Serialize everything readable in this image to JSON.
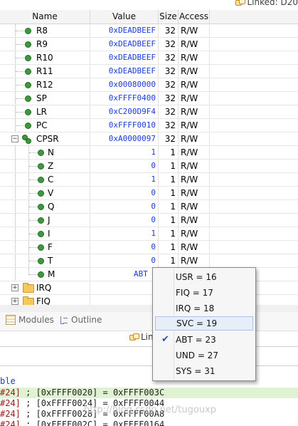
{
  "header": {
    "linked_label": "Linked: D20"
  },
  "columns": {
    "name": "Name",
    "value": "Value",
    "size": "Size",
    "access": "Access"
  },
  "registers": [
    {
      "name": "R8",
      "value": "0xDEADBEEF",
      "size": "32",
      "access": "R/W"
    },
    {
      "name": "R9",
      "value": "0xDEADBEEF",
      "size": "32",
      "access": "R/W"
    },
    {
      "name": "R10",
      "value": "0xDEADBEEF",
      "size": "32",
      "access": "R/W"
    },
    {
      "name": "R11",
      "value": "0xDEADBEEF",
      "size": "32",
      "access": "R/W"
    },
    {
      "name": "R12",
      "value": "0x00080000",
      "size": "32",
      "access": "R/W"
    },
    {
      "name": "SP",
      "value": "0xFFFF0400",
      "size": "32",
      "access": "R/W"
    },
    {
      "name": "LR",
      "value": "0xC200D9F4",
      "size": "32",
      "access": "R/W"
    },
    {
      "name": "PC",
      "value": "0xFFFF0010",
      "size": "32",
      "access": "R/W"
    }
  ],
  "cpsr": {
    "name": "CPSR",
    "value": "0xA0000097",
    "size": "32",
    "access": "R/W"
  },
  "cpsr_fields": [
    {
      "name": "N",
      "value": "1",
      "size": "1",
      "access": "R/W"
    },
    {
      "name": "Z",
      "value": "0",
      "size": "1",
      "access": "R/W"
    },
    {
      "name": "C",
      "value": "1",
      "size": "1",
      "access": "R/W"
    },
    {
      "name": "V",
      "value": "0",
      "size": "1",
      "access": "R/W"
    },
    {
      "name": "Q",
      "value": "0",
      "size": "1",
      "access": "R/W"
    },
    {
      "name": "J",
      "value": "0",
      "size": "1",
      "access": "R/W"
    },
    {
      "name": "I",
      "value": "1",
      "size": "1",
      "access": "R/W"
    },
    {
      "name": "F",
      "value": "0",
      "size": "1",
      "access": "R/W"
    },
    {
      "name": "T",
      "value": "0",
      "size": "1",
      "access": "R/W"
    },
    {
      "name": "M",
      "value": "ABT",
      "size": "",
      "access": ""
    }
  ],
  "groups": [
    {
      "name": "IRQ"
    },
    {
      "name": "FIQ"
    }
  ],
  "mode_dropdown": {
    "selected": "ABT = 23",
    "hovered": "SVC = 19",
    "options": [
      "USR = 16",
      "FIQ = 17",
      "IRQ = 18",
      "SVC = 19",
      "ABT = 23",
      "UND = 27",
      "SYS = 31"
    ]
  },
  "views": {
    "modules_label": "Modules",
    "outline_label": "Outline",
    "linked_short": "Lin"
  },
  "disassembly": {
    "header": "ble",
    "lines": [
      {
        "prefix": "#24]",
        "text": " ; [0xFFFF0020] = 0xFFFF003C"
      },
      {
        "prefix": "#24]",
        "text": " ; [0xFFFF0024] = 0xFFFF0044"
      },
      {
        "prefix": "#24]",
        "text": " ; [0xFFFF0028] = 0xFFFF00A8"
      },
      {
        "prefix": "#24]",
        "text": " ; [0xFFFF002C] = 0xFFFF0164"
      }
    ]
  },
  "watermark": "http://blog.csdn.net/tugouxp",
  "colors": {
    "value_text": "#1a3cd6",
    "status_dot": "#3b9a3b",
    "disasm_highlight": "#dff3d2"
  }
}
